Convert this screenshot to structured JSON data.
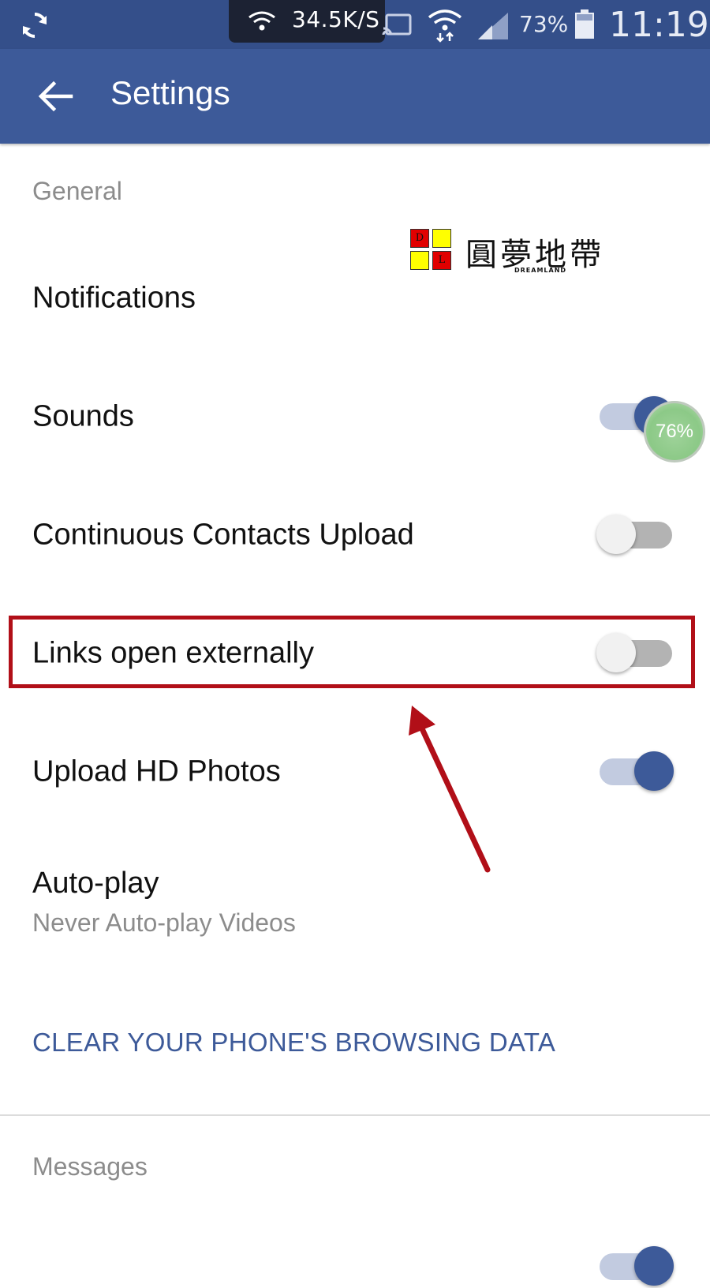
{
  "status_bar": {
    "network_speed": "34.5K/S",
    "battery_percent": "73%",
    "time": "11:19",
    "icons": [
      "sync-icon",
      "wifi-icon",
      "cast-icon",
      "wifi-transfer-icon",
      "cell-signal-icon",
      "battery-icon"
    ]
  },
  "app_bar": {
    "title": "Settings",
    "back_icon": "arrow-back-icon",
    "color": "#3d5a99"
  },
  "sections": {
    "general": "General",
    "messages": "Messages"
  },
  "settings": [
    {
      "label": "Notifications"
    },
    {
      "label": "Sounds",
      "toggle": true
    },
    {
      "label": "Continuous Contacts Upload",
      "toggle": false
    },
    {
      "label": "Links open externally",
      "toggle": false
    },
    {
      "label": "Upload HD Photos",
      "toggle": true
    }
  ],
  "autoplay": {
    "title": "Auto-play",
    "value": "Never Auto-play Videos"
  },
  "clear_data_link": "CLEAR YOUR PHONE'S BROWSING DATA",
  "overlays": {
    "logo_text": "圓夢地帶",
    "logo_subtext": "DREAMLAND",
    "logo_letters": [
      "D",
      "L"
    ],
    "progress_bubble": "76%"
  },
  "colors": {
    "accent": "#3d5a99",
    "status_bar": "#344f8a",
    "annotation": "#b10f18"
  }
}
